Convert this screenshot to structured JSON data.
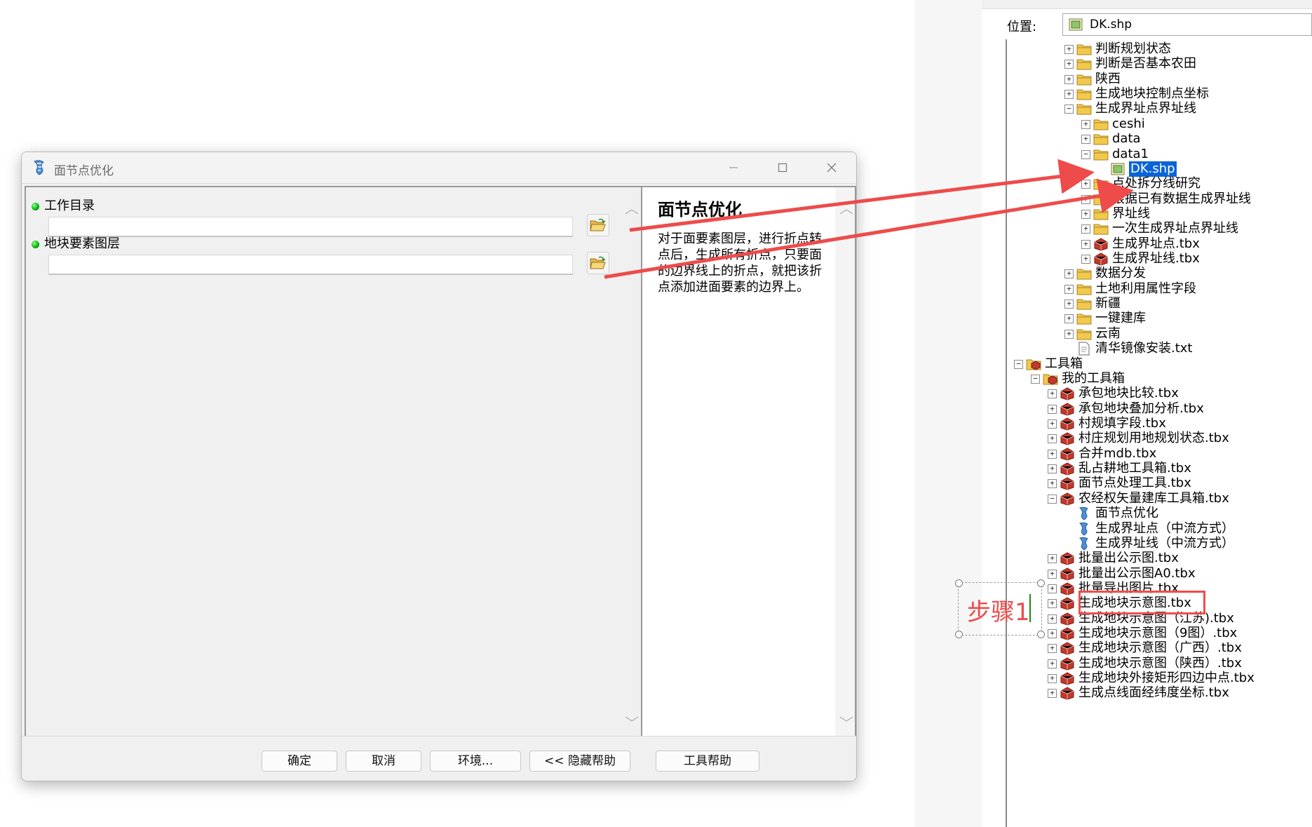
{
  "dialog": {
    "title": "面节点优化",
    "params": [
      {
        "label": "工作目录",
        "value": "",
        "required": true
      },
      {
        "label": "地块要素图层",
        "value": "",
        "required": true
      }
    ],
    "help": {
      "title": "面节点优化",
      "body": "对于面要素图层，进行折点转点后，生成所有折点，只要面的边界线上的折点，就把该折点添加进面要素的边界上。"
    },
    "buttons": {
      "ok": "确定",
      "cancel": "取消",
      "env": "环境...",
      "hide_help": "<< 隐藏帮助",
      "tool_help": "工具帮助"
    }
  },
  "catalog": {
    "location_label": "位置:",
    "location_value": "DK.shp",
    "tree": [
      {
        "label": "判断规划状态",
        "icon": "folder-icon",
        "depth": 3,
        "expander": "+"
      },
      {
        "label": "判断是否基本农田",
        "icon": "folder-icon",
        "depth": 3,
        "expander": "+"
      },
      {
        "label": "陕西",
        "icon": "folder-icon",
        "depth": 3,
        "expander": "+"
      },
      {
        "label": "生成地块控制点坐标",
        "icon": "folder-icon",
        "depth": 3,
        "expander": "+"
      },
      {
        "label": "生成界址点界址线",
        "icon": "folder-icon",
        "depth": 3,
        "expander": "-"
      },
      {
        "label": "ceshi",
        "icon": "folder-icon",
        "depth": 4,
        "expander": "+"
      },
      {
        "label": "data",
        "icon": "folder-icon",
        "depth": 4,
        "expander": "+"
      },
      {
        "label": "data1",
        "icon": "folder-icon",
        "depth": 4,
        "expander": "-"
      },
      {
        "label": "DK.shp",
        "icon": "shapefile-icon",
        "depth": 5,
        "expander": "",
        "selected": true
      },
      {
        "label": "点处拆分线研究",
        "icon": "folder-icon",
        "depth": 4,
        "expander": "+"
      },
      {
        "label": "根据已有数据生成界址线",
        "icon": "folder-icon",
        "depth": 4,
        "expander": "+"
      },
      {
        "label": "界址线",
        "icon": "folder-icon",
        "depth": 4,
        "expander": "+"
      },
      {
        "label": "一次生成界址点界址线",
        "icon": "folder-icon",
        "depth": 4,
        "expander": "+"
      },
      {
        "label": "生成界址点.tbx",
        "icon": "toolbox-icon",
        "depth": 4,
        "expander": "+"
      },
      {
        "label": "生成界址线.tbx",
        "icon": "toolbox-icon",
        "depth": 4,
        "expander": "+"
      },
      {
        "label": "数据分发",
        "icon": "folder-icon",
        "depth": 3,
        "expander": "+"
      },
      {
        "label": "土地利用属性字段",
        "icon": "folder-icon",
        "depth": 3,
        "expander": "+"
      },
      {
        "label": "新疆",
        "icon": "folder-icon",
        "depth": 3,
        "expander": "+"
      },
      {
        "label": "一键建库",
        "icon": "folder-icon",
        "depth": 3,
        "expander": "+"
      },
      {
        "label": "云南",
        "icon": "folder-icon",
        "depth": 3,
        "expander": "+"
      },
      {
        "label": "清华镜像安装.txt",
        "icon": "text-file-icon",
        "depth": 3,
        "expander": ""
      },
      {
        "label": "工具箱",
        "icon": "toolboxes-icon",
        "depth": 0,
        "expander": "-"
      },
      {
        "label": "我的工具箱",
        "icon": "toolboxes-icon",
        "depth": 1,
        "expander": "-"
      },
      {
        "label": "承包地块比较.tbx",
        "icon": "toolbox-icon",
        "depth": 2,
        "expander": "+"
      },
      {
        "label": "承包地块叠加分析.tbx",
        "icon": "toolbox-icon",
        "depth": 2,
        "expander": "+"
      },
      {
        "label": "村规填字段.tbx",
        "icon": "toolbox-icon",
        "depth": 2,
        "expander": "+"
      },
      {
        "label": "村庄规划用地规划状态.tbx",
        "icon": "toolbox-icon",
        "depth": 2,
        "expander": "+"
      },
      {
        "label": "合并mdb.tbx",
        "icon": "toolbox-icon",
        "depth": 2,
        "expander": "+"
      },
      {
        "label": "乱占耕地工具箱.tbx",
        "icon": "toolbox-icon",
        "depth": 2,
        "expander": "+"
      },
      {
        "label": "面节点处理工具.tbx",
        "icon": "toolbox-icon",
        "depth": 2,
        "expander": "+"
      },
      {
        "label": "农经权矢量建库工具箱.tbx",
        "icon": "toolbox-icon",
        "depth": 2,
        "expander": "-"
      },
      {
        "label": "面节点优化",
        "icon": "script-tool-icon",
        "depth": 3,
        "expander": ""
      },
      {
        "label": "生成界址点（中流方式）",
        "icon": "script-tool-icon",
        "depth": 3,
        "expander": ""
      },
      {
        "label": "生成界址线（中流方式）",
        "icon": "script-tool-icon",
        "depth": 3,
        "expander": ""
      },
      {
        "label": "批量出公示图.tbx",
        "icon": "toolbox-icon",
        "depth": 2,
        "expander": "+"
      },
      {
        "label": "批量出公示图A0.tbx",
        "icon": "toolbox-icon",
        "depth": 2,
        "expander": "+"
      },
      {
        "label": "批量导出图片.tbx",
        "icon": "toolbox-icon",
        "depth": 2,
        "expander": "+"
      },
      {
        "label": "生成地块示意图.tbx",
        "icon": "toolbox-icon",
        "depth": 2,
        "expander": "+"
      },
      {
        "label": "生成地块示意图（江苏).tbx",
        "icon": "toolbox-icon",
        "depth": 2,
        "expander": "+"
      },
      {
        "label": "生成地块示意图（9图）.tbx",
        "icon": "toolbox-icon",
        "depth": 2,
        "expander": "+"
      },
      {
        "label": "生成地块示意图（广西）.tbx",
        "icon": "toolbox-icon",
        "depth": 2,
        "expander": "+"
      },
      {
        "label": "生成地块示意图（陕西）.tbx",
        "icon": "toolbox-icon",
        "depth": 2,
        "expander": "+"
      },
      {
        "label": "生成地块外接矩形四边中点.tbx",
        "icon": "toolbox-icon",
        "depth": 2,
        "expander": "+"
      },
      {
        "label": "生成点线面经纬度坐标.tbx",
        "icon": "toolbox-icon",
        "depth": 2,
        "expander": "+"
      }
    ]
  },
  "annotation": {
    "text": "步骤1"
  },
  "colors": {
    "arrow": "#ee4b4b",
    "selection": "#0a64d8",
    "folder": "#f2c94c",
    "toolbox": "#c0392b"
  }
}
